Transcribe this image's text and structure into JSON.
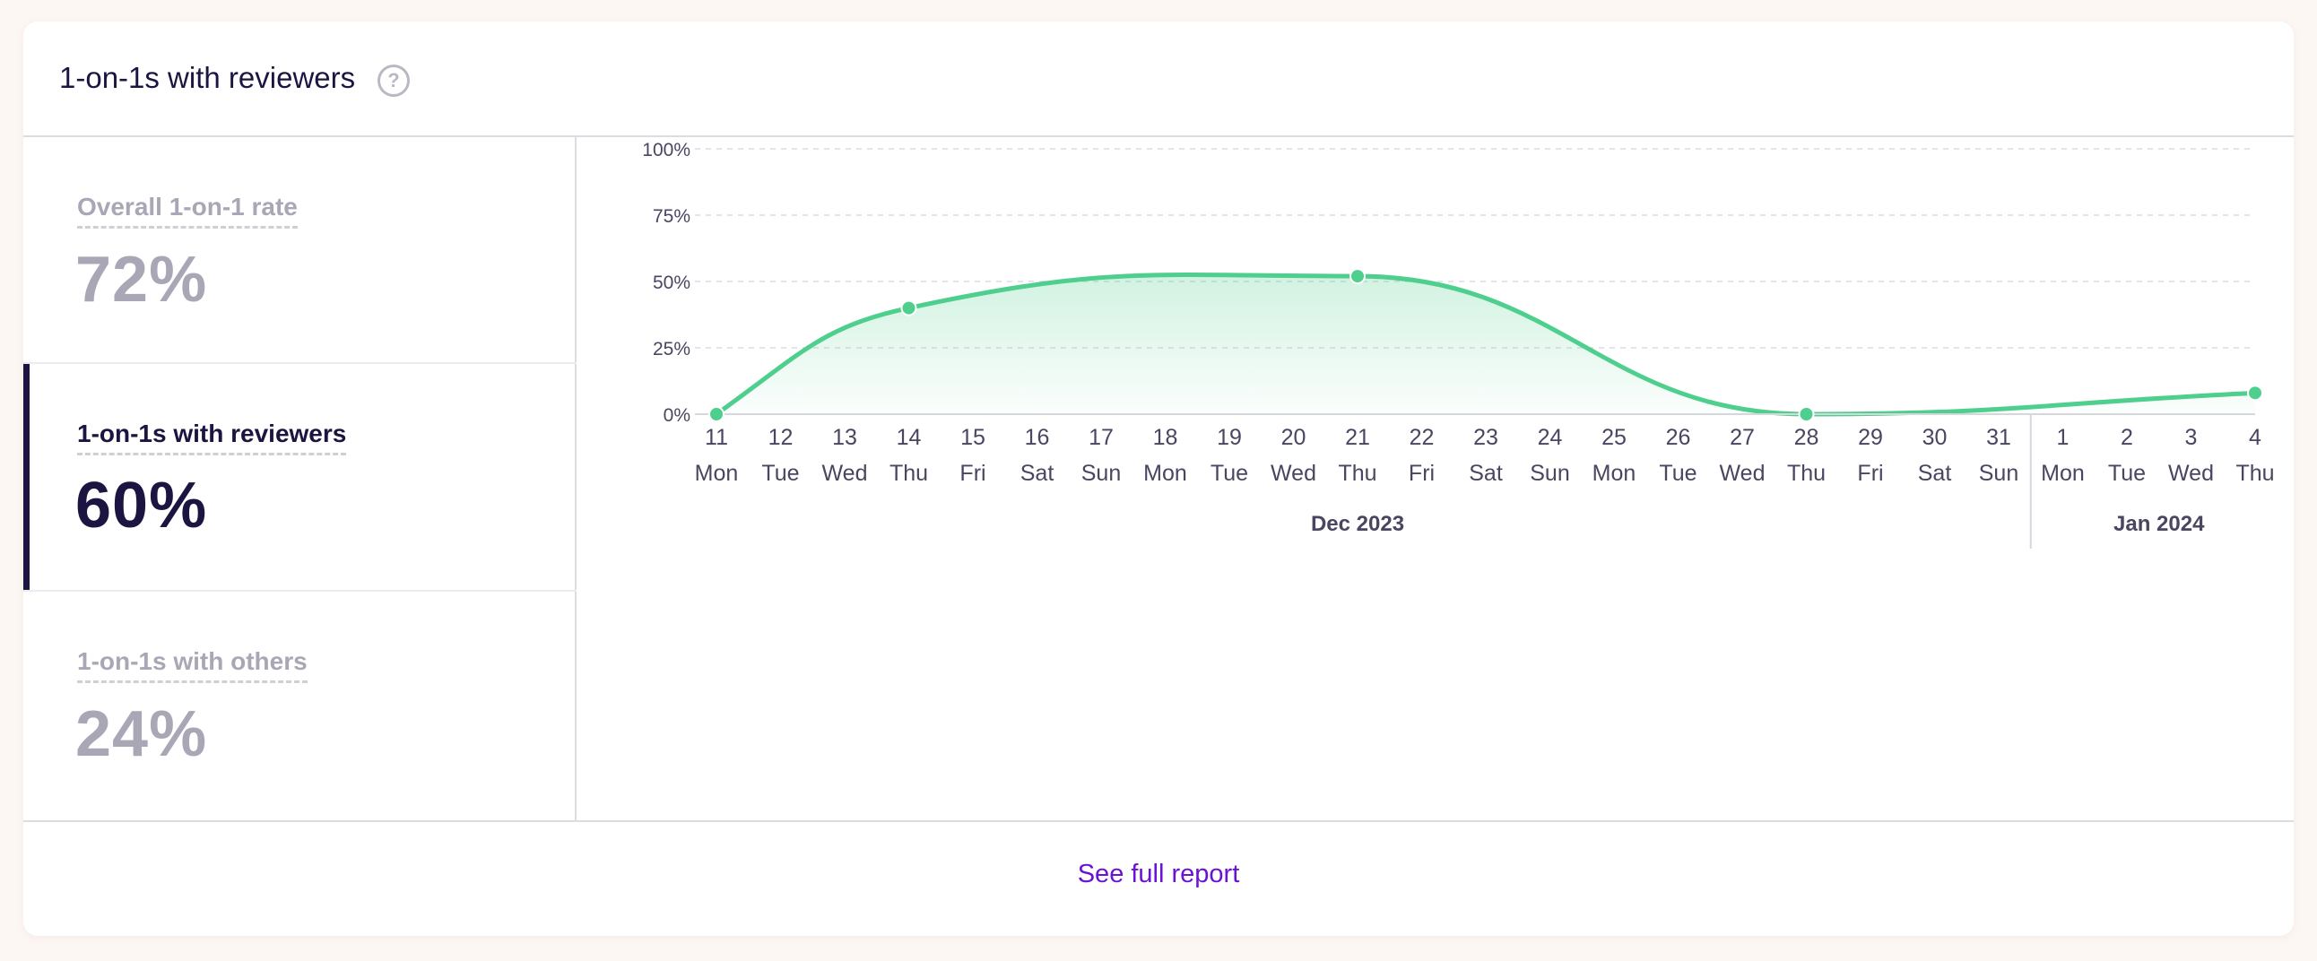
{
  "header": {
    "title": "1-on-1s with reviewers",
    "help_icon": "question-circle-icon"
  },
  "metrics": [
    {
      "label": "Overall 1-on-1 rate",
      "value": "72%",
      "active": false
    },
    {
      "label": "1-on-1s with reviewers",
      "value": "60%",
      "active": true
    },
    {
      "label": "1-on-1s with others",
      "value": "24%",
      "active": false
    }
  ],
  "footer": {
    "link_label": "See full report"
  },
  "colors": {
    "line": "#4fcf8d",
    "active_accent": "#1c1441",
    "link": "#6a12d6"
  },
  "chart_data": {
    "type": "area",
    "y_ticks": [
      "0%",
      "25%",
      "50%",
      "75%",
      "100%"
    ],
    "ylim": [
      0,
      100
    ],
    "grid": true,
    "x_days": [
      {
        "day": "11",
        "weekday": "Mon"
      },
      {
        "day": "12",
        "weekday": "Tue"
      },
      {
        "day": "13",
        "weekday": "Wed"
      },
      {
        "day": "14",
        "weekday": "Thu"
      },
      {
        "day": "15",
        "weekday": "Fri"
      },
      {
        "day": "16",
        "weekday": "Sat"
      },
      {
        "day": "17",
        "weekday": "Sun"
      },
      {
        "day": "18",
        "weekday": "Mon"
      },
      {
        "day": "19",
        "weekday": "Tue"
      },
      {
        "day": "20",
        "weekday": "Wed"
      },
      {
        "day": "21",
        "weekday": "Thu"
      },
      {
        "day": "22",
        "weekday": "Fri"
      },
      {
        "day": "23",
        "weekday": "Sat"
      },
      {
        "day": "24",
        "weekday": "Sun"
      },
      {
        "day": "25",
        "weekday": "Mon"
      },
      {
        "day": "26",
        "weekday": "Tue"
      },
      {
        "day": "27",
        "weekday": "Wed"
      },
      {
        "day": "28",
        "weekday": "Thu"
      },
      {
        "day": "29",
        "weekday": "Fri"
      },
      {
        "day": "30",
        "weekday": "Sat"
      },
      {
        "day": "31",
        "weekday": "Sun"
      },
      {
        "day": "1",
        "weekday": "Mon"
      },
      {
        "day": "2",
        "weekday": "Tue"
      },
      {
        "day": "3",
        "weekday": "Wed"
      },
      {
        "day": "4",
        "weekday": "Thu"
      }
    ],
    "months": [
      {
        "label": "Dec 2023",
        "first_index": 0,
        "last_index": 20
      },
      {
        "label": "Jan 2024",
        "first_index": 21,
        "last_index": 24
      }
    ],
    "points": [
      {
        "date": "2023-12-11",
        "value": 0
      },
      {
        "date": "2023-12-14",
        "value": 40
      },
      {
        "date": "2023-12-21",
        "value": 52
      },
      {
        "date": "2023-12-28",
        "value": 0
      },
      {
        "date": "2024-01-04",
        "value": 8
      }
    ]
  }
}
